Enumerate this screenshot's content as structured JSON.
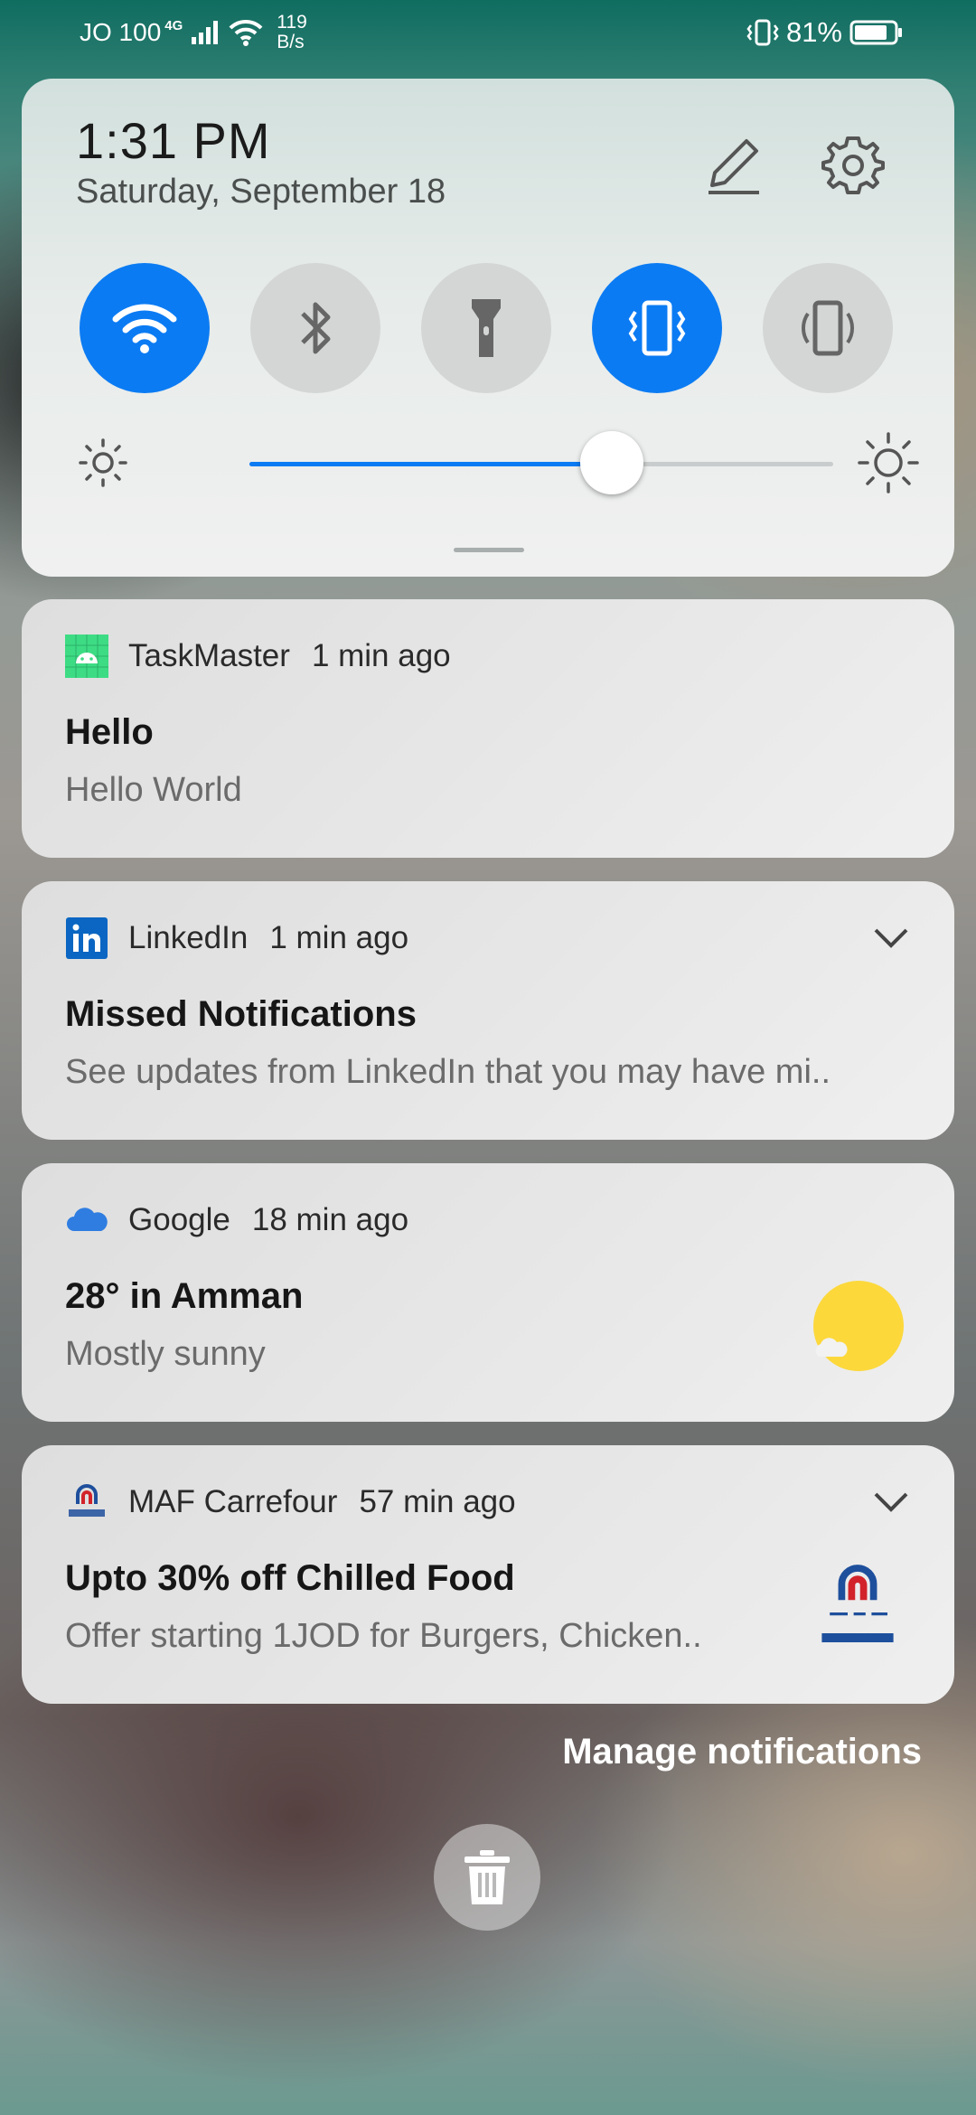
{
  "status_bar": {
    "carrier": "JO 100",
    "network": "4G",
    "speed_value": "119",
    "speed_unit": "B/s",
    "battery": "81%"
  },
  "quick_panel": {
    "time": "1:31  PM",
    "date": "Saturday, September 18",
    "toggles": [
      {
        "name": "wifi",
        "icon": "wifi-icon",
        "state": "on"
      },
      {
        "name": "bluetooth",
        "icon": "bluetooth-icon",
        "state": "off"
      },
      {
        "name": "flashlight",
        "icon": "flashlight-icon",
        "state": "off"
      },
      {
        "name": "vibrate",
        "icon": "vibrate-icon",
        "state": "on"
      },
      {
        "name": "auto-rotate",
        "icon": "rotate-icon",
        "state": "off"
      }
    ],
    "brightness_fraction": 0.62,
    "accent_color": "#0b7bf3"
  },
  "notifications": [
    {
      "app": "TaskMaster",
      "time": "1 min ago",
      "title": "Hello",
      "body": "Hello World",
      "icon": "android-icon"
    },
    {
      "app": "LinkedIn",
      "time": "1 min ago",
      "title": "Missed Notifications",
      "body": "See updates from LinkedIn that you may have mi..",
      "icon": "linkedin-icon"
    },
    {
      "app": "Google",
      "time": "18 min ago",
      "title": "28° in Amman",
      "body": "Mostly sunny",
      "icon": "cloud-icon"
    },
    {
      "app": "MAF Carrefour",
      "time": "57 min ago",
      "title": "Upto 30% off Chilled Food",
      "body": "Offer starting 1JOD for Burgers, Chicken..",
      "icon": "carrefour-icon"
    }
  ],
  "manage_label": "Manage notifications"
}
